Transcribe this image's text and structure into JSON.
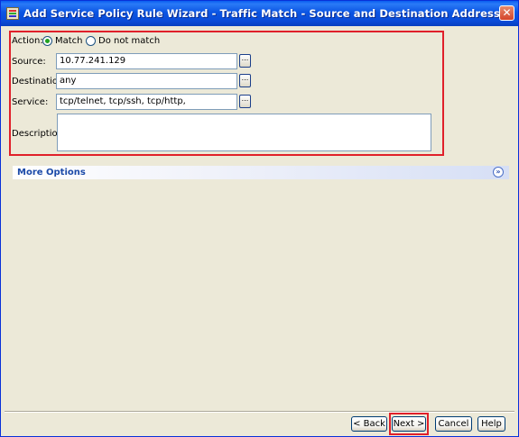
{
  "window": {
    "title": "Add Service Policy Rule Wizard - Traffic Match - Source and Destination Address"
  },
  "form": {
    "action": {
      "label": "Action:",
      "options": [
        {
          "label": "Match",
          "selected": true
        },
        {
          "label": "Do not match",
          "selected": false
        }
      ]
    },
    "source": {
      "label": "Source:",
      "value": "10.77.241.129"
    },
    "destination": {
      "label": "Destination",
      "value": "any"
    },
    "service": {
      "label": "Service:",
      "value": "tcp/telnet, tcp/ssh, tcp/http,"
    },
    "description": {
      "label": "Description:",
      "value": ""
    },
    "browse_label": "..."
  },
  "more_options": {
    "label": "More Options",
    "expand_icon": "double-chevron-down-icon"
  },
  "footer": {
    "back_label": "< Back",
    "next_label": "Next >",
    "cancel_label": "Cancel",
    "help_label": "Help"
  },
  "colors": {
    "highlight": "#e0202a",
    "title_bar": "#0b55e3",
    "link": "#1b4aa8"
  }
}
